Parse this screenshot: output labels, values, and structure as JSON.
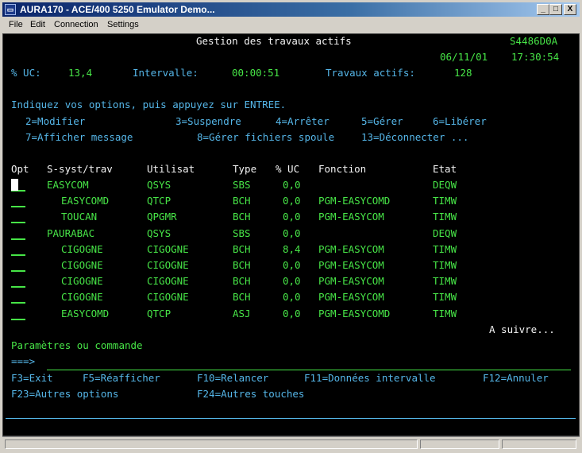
{
  "window": {
    "title": "AURA170 - ACE/400 5250 Emulator Demo...",
    "minimize": "_",
    "maximize": "□",
    "close": "X"
  },
  "menu": [
    "File",
    "Edit",
    "Connection",
    "Settings"
  ],
  "header": {
    "title": "Gestion des travaux actifs",
    "system": "S4486D0A",
    "date": "06/11/01",
    "time": "17:30:54",
    "uc_label": "% UC:",
    "uc_value": "13,4",
    "interval_label": "Intervalle:",
    "interval_value": "00:00:51",
    "jobs_label": "Travaux actifs:",
    "jobs_value": "128"
  },
  "instructions": {
    "line1": "Indiquez vos options, puis appuyez sur ENTREE.",
    "options_row1": [
      "2=Modifier",
      "3=Suspendre",
      "4=Arrêter",
      "5=Gérer",
      "6=Libérer"
    ],
    "options_row2": [
      "7=Afficher message",
      "8=Gérer fichiers spoule",
      "13=Déconnecter ..."
    ]
  },
  "table": {
    "headers": [
      "Opt",
      "S-syst/trav",
      "Utilisat",
      "Type",
      "% UC",
      "Fonction",
      "Etat"
    ],
    "rows": [
      [
        "EASYCOM",
        "QSYS",
        "SBS",
        "0,0",
        "",
        "DEQW"
      ],
      [
        "EASYCOMD",
        "QTCP",
        "BCH",
        "0,0",
        "PGM-EASYCOMD",
        "TIMW"
      ],
      [
        "TOUCAN",
        "QPGMR",
        "BCH",
        "0,0",
        "PGM-EASYCOM",
        "TIMW"
      ],
      [
        "PAURABAC",
        "QSYS",
        "SBS",
        "0,0",
        "",
        "DEQW"
      ],
      [
        "CIGOGNE",
        "CIGOGNE",
        "BCH",
        "8,4",
        "PGM-EASYCOM",
        "TIMW"
      ],
      [
        "CIGOGNE",
        "CIGOGNE",
        "BCH",
        "0,0",
        "PGM-EASYCOM",
        "TIMW"
      ],
      [
        "CIGOGNE",
        "CIGOGNE",
        "BCH",
        "0,0",
        "PGM-EASYCOM",
        "TIMW"
      ],
      [
        "CIGOGNE",
        "CIGOGNE",
        "BCH",
        "0,0",
        "PGM-EASYCOM",
        "TIMW"
      ],
      [
        "EASYCOMD",
        "QTCP",
        "ASJ",
        "0,0",
        "PGM-EASYCOMD",
        "TIMW"
      ]
    ],
    "more": "A suivre..."
  },
  "command": {
    "label": "Paramètres ou commande",
    "prompt": "===>"
  },
  "fkeys": {
    "row1": [
      "F3=Exit",
      "F5=Réafficher",
      "F10=Relancer",
      "F11=Données intervalle",
      "F12=Annuler"
    ],
    "row2": [
      "F23=Autres options",
      "F24=Autres touches"
    ]
  }
}
